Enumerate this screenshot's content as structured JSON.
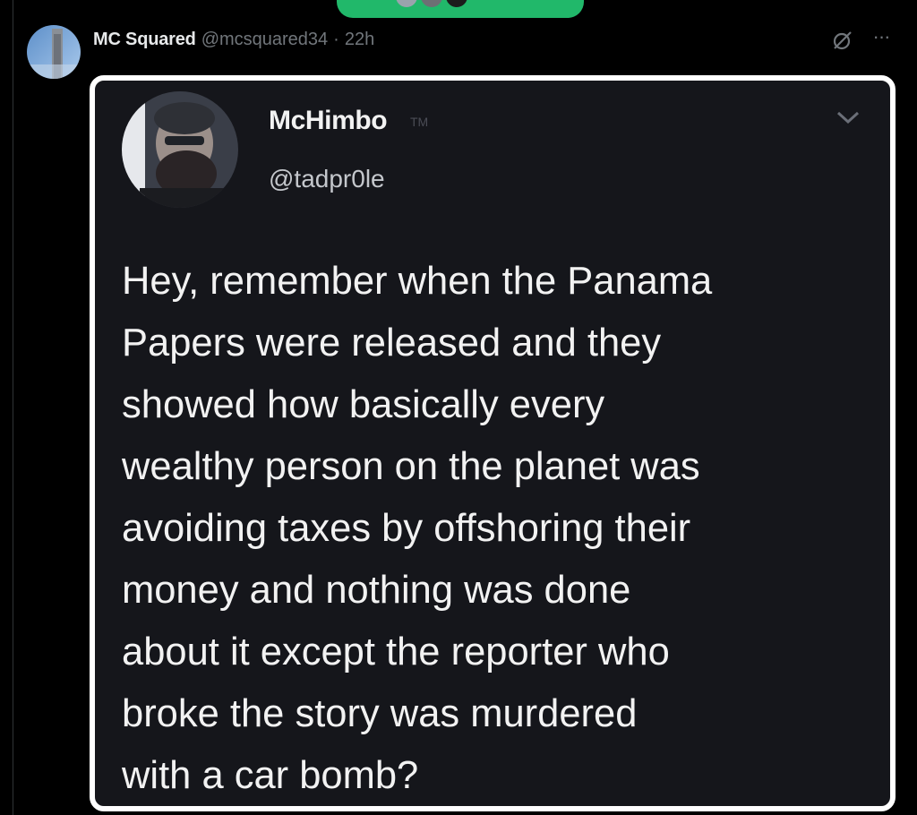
{
  "post": {
    "author_name": "MC Squared",
    "author_handle": "@mcsquared34",
    "separator": "·",
    "time": "22h",
    "more_label": "···"
  },
  "embedded_tweet": {
    "name": "McHimbo",
    "name_suffix": "TM",
    "handle": "@tadpr0le",
    "body_lines": [
      "Hey, remember when the Panama",
      "Papers were released and they",
      "showed how basically every",
      "wealthy person on the planet was",
      "avoiding taxes by offshoring their",
      "money and nothing was done",
      "about it except the reporter who",
      "broke the story was murdered",
      "with a car bomb?"
    ]
  },
  "icons": {
    "avatar": "avatar-photo",
    "grok": "grok-icon",
    "more": "more-options-icon",
    "chevron": "chevron-down-icon"
  },
  "colors": {
    "background": "#000000",
    "muted_text": "#71767b",
    "primary_text": "#e7e9ea",
    "pill_green": "#21b86a",
    "media_border": "#ffffff",
    "embedded_bg": "#15161b"
  }
}
